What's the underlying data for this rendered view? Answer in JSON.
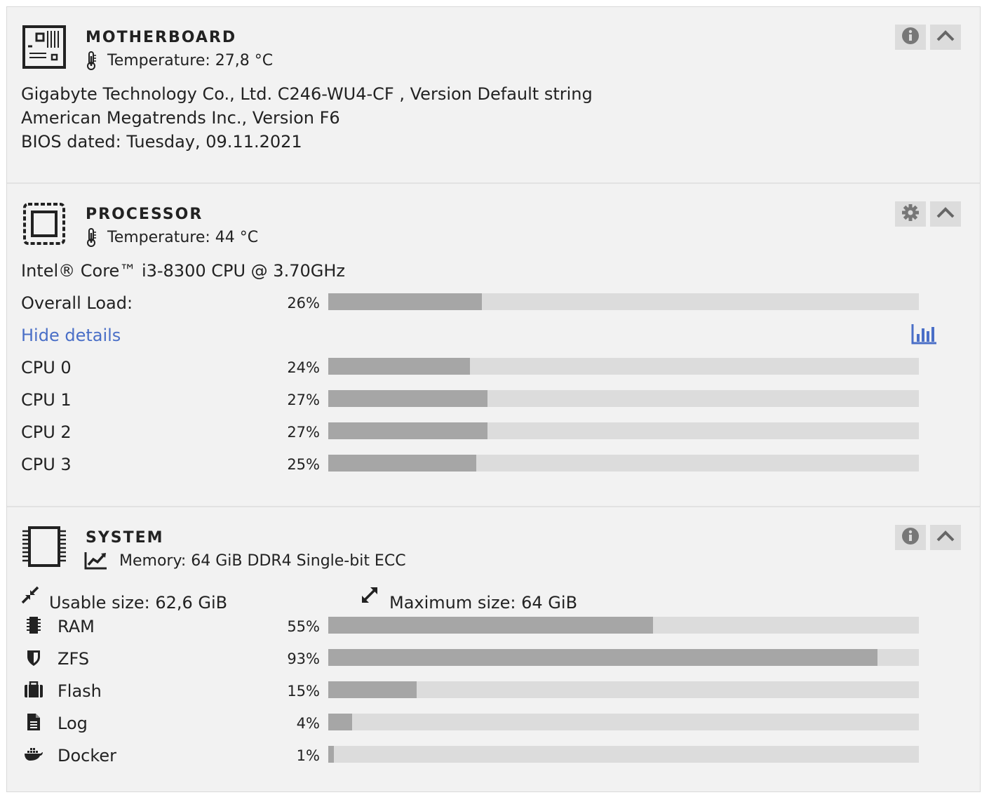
{
  "motherboard": {
    "title": "MOTHERBOARD",
    "temperature": "Temperature: 27,8 °C",
    "lines": [
      "Gigabyte Technology Co., Ltd. C246-WU4-CF , Version Default string",
      "American Megatrends Inc., Version F6",
      "BIOS dated: Tuesday, 09.11.2021"
    ],
    "icons": [
      "motherboard-icon",
      "thermometer-icon",
      "info-icon",
      "chevron-up-icon"
    ]
  },
  "processor": {
    "title": "PROCESSOR",
    "temperature": "Temperature: 44 °C",
    "model": "Intel® Core™ i3-8300 CPU @ 3.70GHz",
    "overall_label": "Overall Load:",
    "overall_pct": "26%",
    "overall_value": 26,
    "hide_details": "Hide details",
    "cores": [
      {
        "label": "CPU 0",
        "pct": "24%",
        "value": 24
      },
      {
        "label": "CPU 1",
        "pct": "27%",
        "value": 27
      },
      {
        "label": "CPU 2",
        "pct": "27%",
        "value": 27
      },
      {
        "label": "CPU 3",
        "pct": "25%",
        "value": 25
      }
    ],
    "icons": [
      "cpu-icon",
      "thermometer-icon",
      "gear-icon",
      "chevron-up-icon",
      "bar-chart-icon"
    ]
  },
  "system": {
    "title": "SYSTEM",
    "memory": "Memory: 64 GiB DDR4 Single-bit ECC",
    "usable": "Usable size: 62,6 GiB",
    "maximum": "Maximum size: 64 GiB",
    "rows": [
      {
        "label": "RAM",
        "pct": "55%",
        "value": 55,
        "icon": "memory-chip-icon"
      },
      {
        "label": "ZFS",
        "pct": "93%",
        "value": 93,
        "icon": "shield-icon"
      },
      {
        "label": "Flash",
        "pct": "15%",
        "value": 15,
        "icon": "briefcase-icon"
      },
      {
        "label": "Log",
        "pct": "4%",
        "value": 4,
        "icon": "document-icon"
      },
      {
        "label": "Docker",
        "pct": "1%",
        "value": 1,
        "icon": "docker-icon"
      }
    ],
    "icons": [
      "memory-module-icon",
      "line-chart-icon",
      "compress-icon",
      "expand-icon",
      "info-icon",
      "chevron-up-icon"
    ]
  },
  "colors": {
    "panel_bg": "#f2f2f2",
    "bar_track": "#dcdcdc",
    "bar_fill": "#a6a6a6",
    "link": "#4a6fc7",
    "button_bg": "#dcdcdc"
  }
}
